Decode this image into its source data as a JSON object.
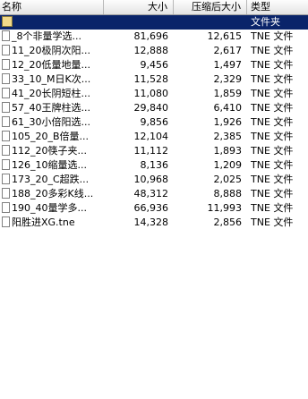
{
  "columns": {
    "name": "名称",
    "size": "大小",
    "compressed": "压缩后大小",
    "type": "类型"
  },
  "rows": [
    {
      "name": "",
      "size": "",
      "compressed": "",
      "type": "文件夹",
      "icon": "folder-up-icon",
      "selected": true
    },
    {
      "name": "_8个非量学选...",
      "size": "81,696",
      "compressed": "12,615",
      "type": "TNE 文件",
      "icon": "file-icon"
    },
    {
      "name": "11_20极阴次阳...",
      "size": "12,888",
      "compressed": "2,617",
      "type": "TNE 文件",
      "icon": "file-icon"
    },
    {
      "name": "12_20低量地量...",
      "size": "9,456",
      "compressed": "1,497",
      "type": "TNE 文件",
      "icon": "file-icon"
    },
    {
      "name": "33_10_M日K次...",
      "size": "11,528",
      "compressed": "2,329",
      "type": "TNE 文件",
      "icon": "file-icon"
    },
    {
      "name": "41_20长阴短柱...",
      "size": "11,080",
      "compressed": "1,859",
      "type": "TNE 文件",
      "icon": "file-icon"
    },
    {
      "name": "57_40王牌柱选...",
      "size": "29,840",
      "compressed": "6,410",
      "type": "TNE 文件",
      "icon": "file-icon"
    },
    {
      "name": "61_30小倍阳选...",
      "size": "9,856",
      "compressed": "1,926",
      "type": "TNE 文件",
      "icon": "file-icon"
    },
    {
      "name": "105_20_B倍量...",
      "size": "12,104",
      "compressed": "2,385",
      "type": "TNE 文件",
      "icon": "file-icon"
    },
    {
      "name": "112_20筷子夹...",
      "size": "11,112",
      "compressed": "1,893",
      "type": "TNE 文件",
      "icon": "file-icon"
    },
    {
      "name": "126_10缩量选...",
      "size": "8,136",
      "compressed": "1,209",
      "type": "TNE 文件",
      "icon": "file-icon"
    },
    {
      "name": "173_20_C超跌...",
      "size": "10,968",
      "compressed": "2,025",
      "type": "TNE 文件",
      "icon": "file-icon"
    },
    {
      "name": "188_20多彩K线...",
      "size": "48,312",
      "compressed": "8,888",
      "type": "TNE 文件",
      "icon": "file-icon"
    },
    {
      "name": "190_40量学多...",
      "size": "66,936",
      "compressed": "11,993",
      "type": "TNE 文件",
      "icon": "file-icon"
    },
    {
      "name": "阳胜进XG.tne",
      "size": "14,328",
      "compressed": "2,856",
      "type": "TNE 文件",
      "icon": "file-icon"
    }
  ]
}
